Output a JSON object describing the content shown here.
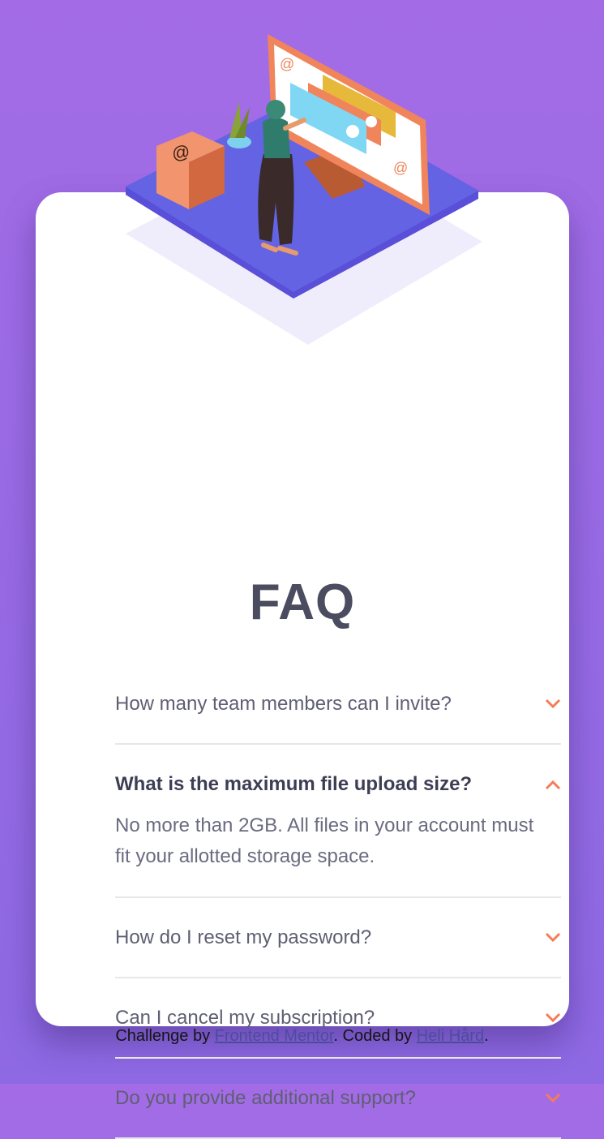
{
  "title": "FAQ",
  "faq": [
    {
      "question": "How many team members can I invite?",
      "open": false,
      "answer": ""
    },
    {
      "question": "What is the maximum file upload size?",
      "open": true,
      "answer": "No more than 2GB. All files in your account must fit your allotted storage space."
    },
    {
      "question": "How do I reset my password?",
      "open": false,
      "answer": ""
    },
    {
      "question": "Can I cancel my subscription?",
      "open": false,
      "answer": ""
    },
    {
      "question": "Do you provide additional support?",
      "open": false,
      "answer": ""
    }
  ],
  "footer": {
    "prefix": "Challenge by ",
    "link1": "Frontend Mentor",
    "middle": ". Coded by ",
    "link2": "Heli Hård",
    "suffix": "."
  },
  "icons": {
    "chevron_down": "chevron-down-icon",
    "chevron_up": "chevron-up-icon",
    "illustration": "woman-online-illustration"
  },
  "colors": {
    "background_top": "#a36ce6",
    "background_bottom": "#8d69e3",
    "heading": "#4b4c5f",
    "accent": "#f47c57",
    "divider": "#e7e7e9"
  }
}
